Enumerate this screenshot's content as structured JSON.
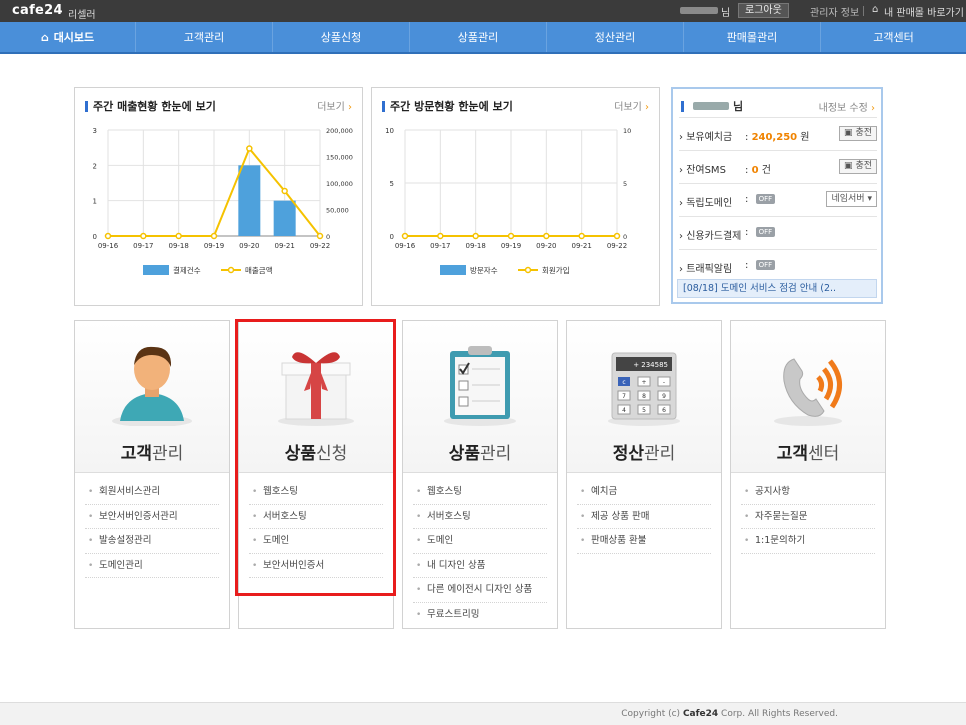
{
  "topbar": {
    "logo": "cafe24",
    "logo_sub": "리셀러",
    "user_suffix": "님",
    "logout": "로그아웃",
    "admin_info": "관리자 정보",
    "shop_link": "내 판매몰 바로가기"
  },
  "nav": [
    {
      "label": "대시보드",
      "icon": "home-icon"
    },
    {
      "label": "고객관리"
    },
    {
      "label": "상품신청"
    },
    {
      "label": "상품관리"
    },
    {
      "label": "정산관리"
    },
    {
      "label": "판매몰관리"
    },
    {
      "label": "고객센터"
    }
  ],
  "sales_panel": {
    "title": "주간 매출현황 한눈에 보기",
    "more": "더보기",
    "legend_bar": "결제건수",
    "legend_line": "매출금액"
  },
  "visit_panel": {
    "title": "주간 방문현황 한눈에 보기",
    "more": "더보기",
    "legend_bar": "방문자수",
    "legend_line": "회원가입"
  },
  "chart_data": [
    {
      "type": "bar",
      "categories": [
        "09-16",
        "09-17",
        "09-18",
        "09-19",
        "09-20",
        "09-21",
        "09-22"
      ],
      "series": [
        {
          "name": "결제건수",
          "type": "bar",
          "axis": "left",
          "values": [
            0,
            0,
            0,
            0,
            2,
            1,
            0
          ],
          "color": "#4ea1dc"
        },
        {
          "name": "매출금액",
          "type": "line",
          "axis": "right",
          "values": [
            0,
            0,
            0,
            0,
            165000,
            85000,
            0
          ],
          "color": "#f5c200"
        }
      ],
      "y_left_ticks": [
        0,
        1,
        2,
        3
      ],
      "y_right_ticks": [
        "0",
        "50,000",
        "100,000",
        "150,000",
        "200,000"
      ],
      "ylim_left": [
        0,
        3
      ],
      "ylim_right": [
        0,
        200000
      ],
      "legend": "bottom",
      "grid": true
    },
    {
      "type": "bar",
      "categories": [
        "09-16",
        "09-17",
        "09-18",
        "09-19",
        "09-20",
        "09-21",
        "09-22"
      ],
      "series": [
        {
          "name": "방문자수",
          "type": "bar",
          "axis": "left",
          "values": [
            0,
            0,
            0,
            0,
            0,
            0,
            0
          ],
          "color": "#4ea1dc"
        },
        {
          "name": "회원가입",
          "type": "line",
          "axis": "right",
          "values": [
            0,
            0,
            0,
            0,
            0,
            0,
            0
          ],
          "color": "#f5c200"
        }
      ],
      "y_left_ticks": [
        0,
        5,
        10
      ],
      "y_right_ticks": [
        "0",
        "5",
        "10"
      ],
      "ylim_left": [
        0,
        10
      ],
      "ylim_right": [
        0,
        10
      ],
      "legend": "bottom",
      "grid": true
    }
  ],
  "account": {
    "name_suffix": "님",
    "edit": "내정보 수정",
    "deposit_label": "보유예치금",
    "deposit_value": "240,250",
    "deposit_unit": "원",
    "charge": "충전",
    "sms_label": "잔여SMS",
    "sms_value": "0",
    "sms_unit": "건",
    "domain_label": "독립도메인",
    "domain_state": "OFF",
    "domain_select": "네임서버",
    "card_label": "신용카드결제",
    "card_state": "OFF",
    "traffic_label": "트래픽알림",
    "traffic_state": "OFF",
    "notice": "[08/18] 도메인 서비스 점검 안내 (2.."
  },
  "tiles": [
    {
      "title_a": "고객",
      "title_b": "관리",
      "items": [
        "회원서비스관리",
        "보안서버인증서관리",
        "발송설정관리",
        "도메인관리"
      ]
    },
    {
      "title_a": "상품",
      "title_b": "신청",
      "items": [
        "웹호스팅",
        "서버호스팅",
        "도메인",
        "보안서버인증서"
      ]
    },
    {
      "title_a": "상품",
      "title_b": "관리",
      "items": [
        "웹호스팅",
        "서버호스팅",
        "도메인",
        "내 디자인 상품",
        "다른 에이전시 디자인 상품",
        "무료스트리밍"
      ]
    },
    {
      "title_a": "정산",
      "title_b": "관리",
      "items": [
        "예치금",
        "제공 상품 판매",
        "판매상품 환불"
      ]
    },
    {
      "title_a": "고객",
      "title_b": "센터",
      "items": [
        "공지사항",
        "자주묻는질문",
        "1:1문의하기"
      ]
    }
  ],
  "calc_display": "+ 234585",
  "calc_keys": [
    "c",
    "+",
    "-",
    "7",
    "8",
    "9",
    "4",
    "5",
    "6"
  ],
  "footer": {
    "prefix": "Copyright (c)",
    "brand": "Cafe24",
    "suffix": "Corp. All Rights Reserved."
  },
  "colors": {
    "nav_bg": "#4a8fd9",
    "topbar_bg": "#3b3b3b",
    "accent_orange": "#f08300",
    "highlight_red": "#e81c1c",
    "bar_blue": "#4ea1dc",
    "line_yellow": "#f5c200"
  }
}
